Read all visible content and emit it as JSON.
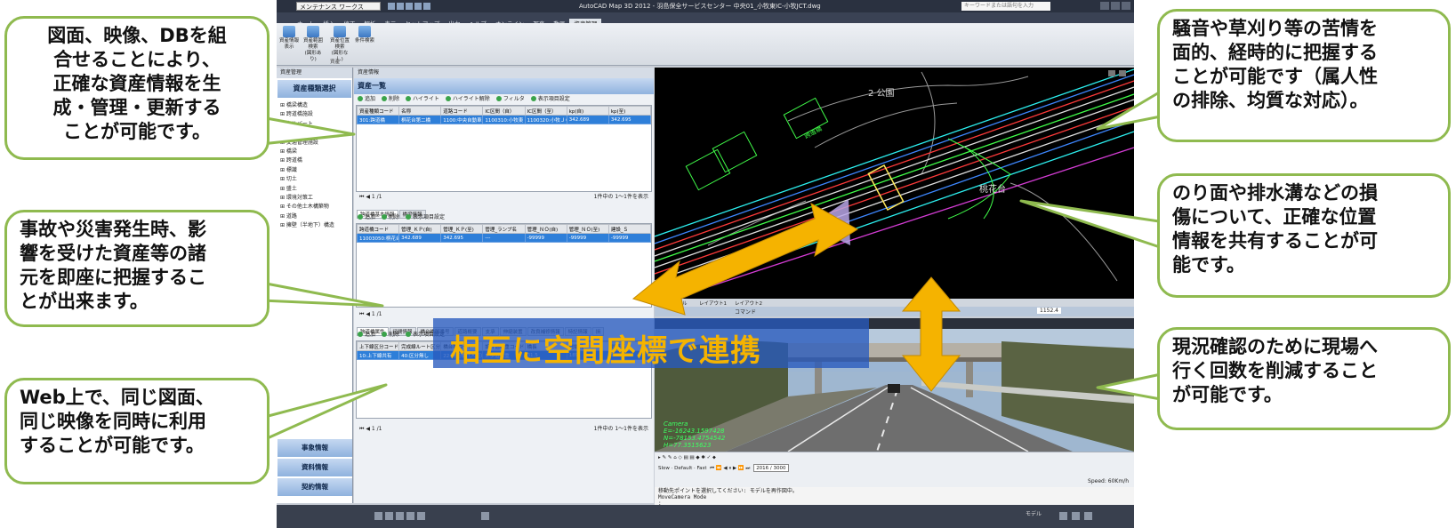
{
  "app": {
    "workspace": "メンテナンス ワークス",
    "title": "AutoCAD Map 3D 2012 - 羽島保全サービスセンター  中央01_小牧東IC-小牧JCT.dwg",
    "search_placeholder": "キーワードまたは語句を入力"
  },
  "menu": {
    "items": [
      "ホーム",
      "挿入",
      "修正",
      "解析",
      "表示",
      "セットアップ",
      "出力",
      "ヘルプ",
      "オンライン",
      "写真",
      "動画",
      "資産管理"
    ],
    "active": "資産管理"
  },
  "ribbon": {
    "buttons": [
      {
        "line1": "資産情報",
        "line2": "表示"
      },
      {
        "line1": "資産範囲検索",
        "line2": "(図形あり)"
      },
      {
        "line1": "資産位置検索",
        "line2": "(図形なし)"
      },
      {
        "line1": "条件検索",
        "line2": ""
      }
    ],
    "group": "資産"
  },
  "left_panel": {
    "header": "資産管理",
    "tab": "資産種類選択",
    "tree": [
      "⊞ 橋梁構造",
      "⊞ 跨道橋施設",
      "⊞ カルバート",
      "⊞ 交通安全施設",
      "⊞ 交通管理施設",
      "⊞ 橋梁",
      "⊞ 跨道橋",
      "⊞ 標識",
      "⊞ 切土",
      "⊞ 盛土",
      "⊞ 環境対策工",
      "⊞ その他土木構築物",
      "⊞ 道路",
      "⊞ 擁壁（半地下）構造"
    ],
    "bottom_tabs": [
      "事象情報",
      "資料情報",
      "契約情報"
    ]
  },
  "asset_panel": {
    "header": "資産情報",
    "title": "資産一覧",
    "toolbar": [
      "追加",
      "削除",
      "ハイライト",
      "ハイライト解除",
      "フィルタ",
      "表示項目設定"
    ],
    "columns": [
      "資産種類コード",
      "名称",
      "道路コード",
      "IC区間（自）",
      "IC区間（至）",
      "kp(自)",
      "kp(至)"
    ],
    "row": [
      "301:跨道橋",
      "桐花台第二橋",
      "1100:中央自動車道",
      "1100310:小牧東",
      "1100320:小牧ＪＣＴ",
      "342.689",
      "342.695"
    ],
    "pager_page": "1",
    "pager_total": "/1",
    "pager_count": "1件中の 1～1件を表示"
  },
  "sub_panel": {
    "tabs": [
      "跨道橋基本情報",
      "橋梁情報"
    ],
    "toolbar": [
      "追加",
      "削除",
      "表示項目設定"
    ],
    "columns": [
      "跨道橋コード",
      "管理_ＫＰ(自)",
      "管理_ＫＰ(至)",
      "管理_ランプ名",
      "管理_ＮＯ(自)",
      "管理_ＮＯ(至)",
      "建設_Ｓ"
    ],
    "row": [
      "11003050:桐花台第二橋",
      "342.689",
      "342.695",
      "---",
      "-99999",
      "-99999",
      "-99999"
    ]
  },
  "attr_panel": {
    "pager_page": "1",
    "pager_total": "/1",
    "tabs": [
      "跨道橋属性",
      "径間情報",
      "橋台橋脚番号",
      "道路概要",
      "支承",
      "伸縮装置",
      "改良補修情報",
      "特記情報",
      "損"
    ],
    "toolbar": [
      "追加",
      "削除",
      "表示項目設定"
    ],
    "columns": [
      "上下線区分コード",
      "完成線ルート区分コード",
      "橋台種コード",
      "設計活荷重コード",
      "橋長",
      "総幅員",
      "総延長"
    ],
    "row": [
      "10:上下線共有",
      "40:区分無し",
      "22:跨道橋（人道）",
      "5:歩道荷重",
      "31.5",
      "189",
      "1"
    ],
    "pager_count": "1件中の 1～1件を表示"
  },
  "cad": {
    "labels": [
      "2 公園",
      "桃花台",
      "跨道橋"
    ],
    "tabs": [
      "モデル",
      "レイアウト1",
      "レイアウト2"
    ],
    "command_label": "コマンド",
    "scale": "1152.4"
  },
  "camera": {
    "coords": [
      "Camera",
      "E=-16243.1597428",
      "N=-78153.4754542",
      "H=77.3515623"
    ],
    "slow": "Slow",
    "default": "Default",
    "fast": "Fast",
    "frame": "2016 / 3000",
    "speed": "Speed: 60Km/h"
  },
  "command_line": [
    "移動先ポイントを選択してください: モデルを再作図中。",
    "MoveCamera Mode",
    ":"
  ],
  "status": {
    "model": "モデル"
  },
  "banner": "相互に空間座標で連携",
  "callouts": {
    "top_left": [
      "図面、映像、DBを組",
      "合せることにより、",
      "正確な資産情報を生",
      "成・管理・更新する",
      "ことが可能です。"
    ],
    "mid_left": [
      "事故や災害発生時、影",
      "響を受けた資産等の諸",
      "元を即座に把握するこ",
      "とが出来ます。"
    ],
    "bottom_left": [
      "Web上で、同じ図面、",
      "同じ映像を同時に利用",
      "することが可能です。"
    ],
    "top_right": [
      "騒音や草刈り等の苦情を",
      "面的、経時的に把握する",
      "ことが可能です（属人性",
      "の排除、均質な対応）。"
    ],
    "mid_right": [
      "のり面や排水溝などの損",
      "傷について、正確な位置",
      "情報を共有することが可",
      "能です。"
    ],
    "bottom_right": [
      "現況確認のために現場へ",
      "行く回数を削減すること",
      "が可能です。"
    ]
  },
  "colors": {
    "callout_border": "#8fba4f",
    "banner_text": "#f5b300",
    "arrow": "#f5b300",
    "selection": "#2e7fd9"
  }
}
